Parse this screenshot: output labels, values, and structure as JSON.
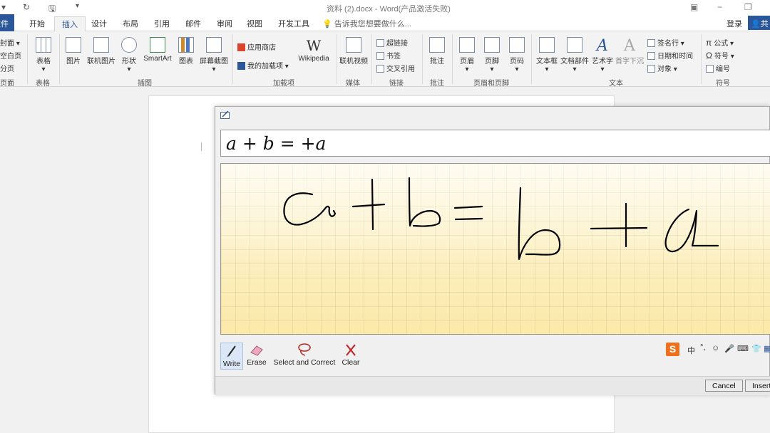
{
  "titlebar": {
    "title": "资料 (2).docx - Word(产品激活失败)"
  },
  "tabs": {
    "file": "文件",
    "items": [
      "开始",
      "插入",
      "设计",
      "布局",
      "引用",
      "邮件",
      "审阅",
      "视图",
      "开发工具"
    ],
    "tell_me": "告诉我您想要做什么...",
    "login": "登录",
    "share": "共享"
  },
  "ribbon": {
    "pages": [
      "封面",
      "空白页",
      "分页"
    ],
    "table": "表格",
    "illustrations": [
      "图片",
      "联机图片",
      "形状",
      "SmartArt",
      "图表",
      "屏幕截图"
    ],
    "addins": [
      "应用商店",
      "我的加载项"
    ],
    "wikipedia": "Wikipedia",
    "media": "联机视频",
    "links": [
      "超链接",
      "书签",
      "交叉引用"
    ],
    "comment": "批注",
    "header_footer": [
      "页眉",
      "页脚",
      "页码"
    ],
    "text": [
      "文本框",
      "文档部件",
      "艺术字",
      "首字下沉"
    ],
    "text_small": [
      "签名行",
      "日期和时间",
      "对象"
    ],
    "symbols": [
      "公式",
      "符号",
      "编号"
    ],
    "groups": {
      "pages": "页面",
      "table": "表格",
      "illustrations": "插图",
      "addins": "加载项",
      "media": "媒体",
      "links": "链接",
      "comment": "批注",
      "header_footer": "页眉和页脚",
      "text": "文本",
      "symbols": "符号"
    }
  },
  "math_panel": {
    "preview": "a + b = +a",
    "tools": {
      "write": "Write",
      "erase": "Erase",
      "select": "Select and Correct",
      "clear": "Clear"
    },
    "cancel": "Cancel",
    "insert": "Insert"
  },
  "ime": {
    "logo": "S",
    "lang": "中"
  },
  "colors": {
    "accent": "#2b579a",
    "grid_yellow": "#fbe9a8"
  }
}
